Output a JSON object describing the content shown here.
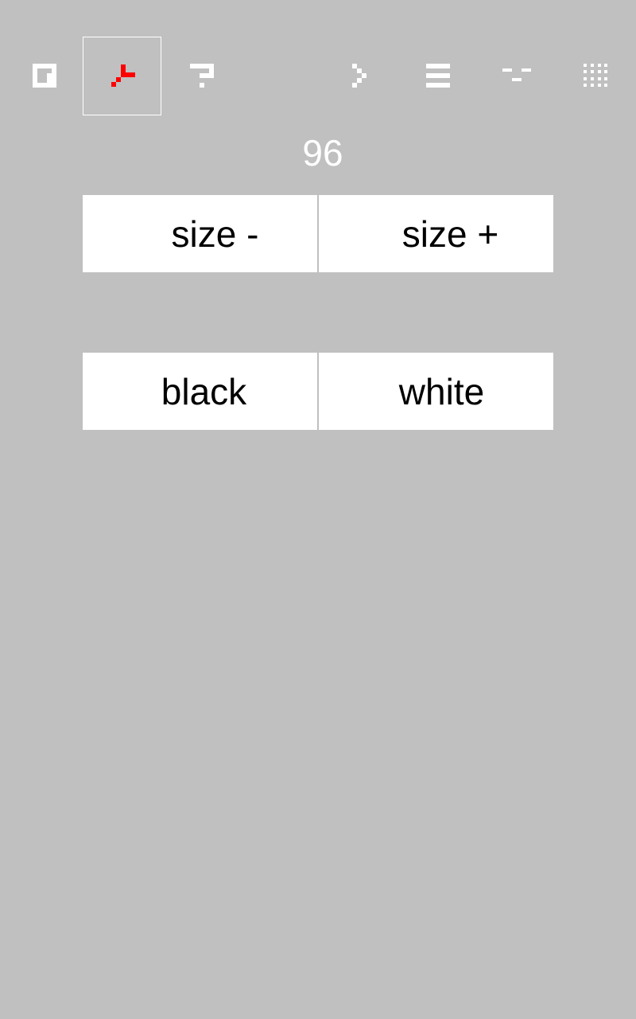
{
  "toolbar": {
    "tools": [
      {
        "icon": "square-corner-icon",
        "selected": false
      },
      {
        "icon": "red-branch-icon",
        "selected": true
      },
      {
        "icon": "question-hook-icon",
        "selected": false
      },
      {
        "icon": "empty-slot",
        "selected": false
      },
      {
        "icon": "chevron-right-icon",
        "selected": false
      },
      {
        "icon": "three-bars-icon",
        "selected": false
      },
      {
        "icon": "dash-pattern-icon",
        "selected": false
      },
      {
        "icon": "dot-grid-icon",
        "selected": false
      }
    ],
    "selected_color": "#ff0000",
    "icon_color": "#ffffff"
  },
  "size_value": "96",
  "size_controls": {
    "decrease_label": "size -",
    "increase_label": "size +"
  },
  "color_controls": {
    "black_label": "black",
    "white_label": "white"
  },
  "colors": {
    "background": "#c0c0c0",
    "button": "#ffffff",
    "button_text": "#000000"
  }
}
